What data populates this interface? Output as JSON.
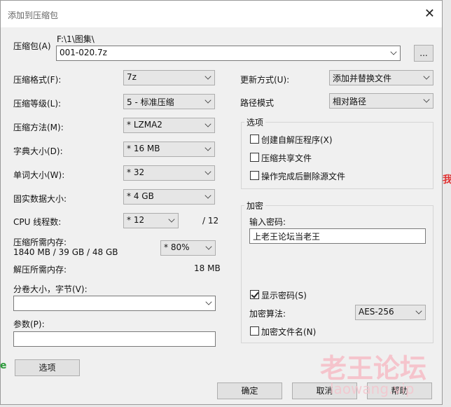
{
  "window": {
    "title": "添加到压缩包",
    "close": "✕"
  },
  "archive": {
    "label": "压缩包(A)",
    "path": "F:\\1\\图集\\",
    "name": "001-020.7z",
    "browse": "..."
  },
  "left": [
    {
      "label": "压缩格式(F):",
      "value": "7z"
    },
    {
      "label": "压缩等级(L):",
      "value": "5 - 标准压缩"
    },
    {
      "label": "压缩方法(M):",
      "value": "* LZMA2"
    },
    {
      "label": "字典大小(D):",
      "value": "* 16 MB"
    },
    {
      "label": "单词大小(W):",
      "value": "* 32"
    },
    {
      "label": "固实数据大小:",
      "value": "* 4 GB"
    }
  ],
  "cpu": {
    "label": "CPU 线程数:",
    "value": "* 12",
    "max": "/ 12"
  },
  "mem": {
    "label": "压缩所需内存:",
    "detail": "1840 MB / 39 GB / 48 GB",
    "value": "* 80%"
  },
  "decomp": {
    "label": "解压所需内存:",
    "value": "18 MB"
  },
  "volume": {
    "label": "分卷大小，字节(V):",
    "value": ""
  },
  "params": {
    "label": "参数(P):",
    "value": ""
  },
  "options_button": "选项",
  "right": {
    "update": {
      "label": "更新方式(U):",
      "value": "添加并替换文件"
    },
    "pathmode": {
      "label": "路径模式",
      "value": "相对路径"
    },
    "options": {
      "title": "选项",
      "items": [
        "创建自解压程序(X)",
        "压缩共享文件",
        "操作完成后删除源文件"
      ]
    },
    "encrypt": {
      "title": "加密",
      "pw_label": "输入密码:",
      "pw_value": "上老王论坛当老王",
      "show_pw": "显示密码(S)",
      "method_label": "加密算法:",
      "method": "AES-256",
      "enc_names": "加密文件名(N)"
    }
  },
  "buttons": {
    "ok": "确定",
    "cancel": "取消",
    "help": "帮助"
  },
  "watermark": {
    "text": "老王论坛",
    "url": "laowang.vip"
  },
  "edge": {
    "right_char": "我",
    "left_char": "e"
  },
  "colors": {
    "watermark": "#f5c4cc",
    "edge_red": "#e03030",
    "edge_green": "#2a9a3a"
  }
}
